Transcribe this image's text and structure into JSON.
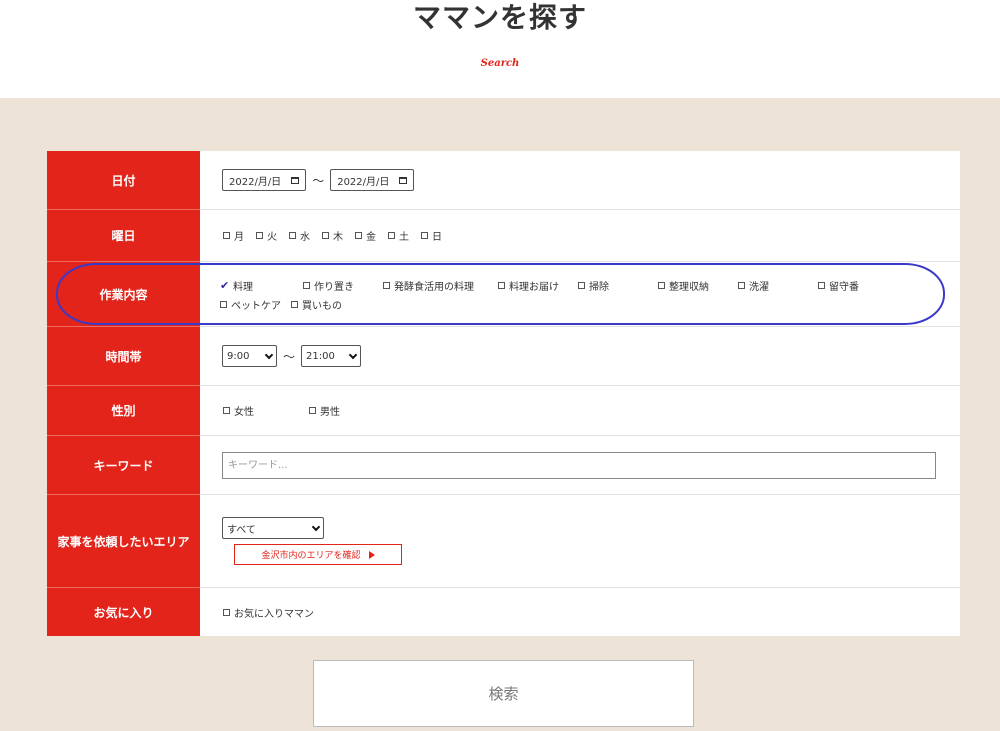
{
  "header": {
    "title": "ママンを探す",
    "subtitle": "Search"
  },
  "form": {
    "date": {
      "label": "日付",
      "start_value": "2022/月/日",
      "separator": "〜",
      "end_value": "2022/月/日"
    },
    "weekday": {
      "label": "曜日",
      "options": [
        "月",
        "火",
        "水",
        "木",
        "金",
        "土",
        "日"
      ]
    },
    "work": {
      "label": "作業内容",
      "checked_mark": "✔",
      "line1": [
        "料理",
        "作り置き",
        "発酵食活用の料理",
        "料理お届け",
        "掃除",
        "整理収納",
        "洗濯",
        "留守番"
      ],
      "line2": [
        "ペットケア",
        "買いもの"
      ]
    },
    "time": {
      "label": "時間帯",
      "start_value": "9:00",
      "separator": "〜",
      "end_value": "21:00"
    },
    "gender": {
      "label": "性別",
      "options": [
        "女性",
        "男性"
      ]
    },
    "keyword": {
      "label": "キーワード",
      "placeholder": "キーワード..."
    },
    "area": {
      "label": "家事を依頼したいエリア",
      "select_value": "すべて",
      "button_label": "金沢市内のエリアを確認"
    },
    "favorite": {
      "label": "お気に入り",
      "option": "お気に入りママン"
    }
  },
  "search_button": {
    "label": "検索"
  },
  "colors": {
    "accent": "#e3241b",
    "background": "#ede4d7",
    "highlight": "#3a3ac9"
  },
  "icons": {
    "calendar": "calendar-icon",
    "dropdown": "chevron-down-icon",
    "arrow": "triangle-right-icon"
  }
}
